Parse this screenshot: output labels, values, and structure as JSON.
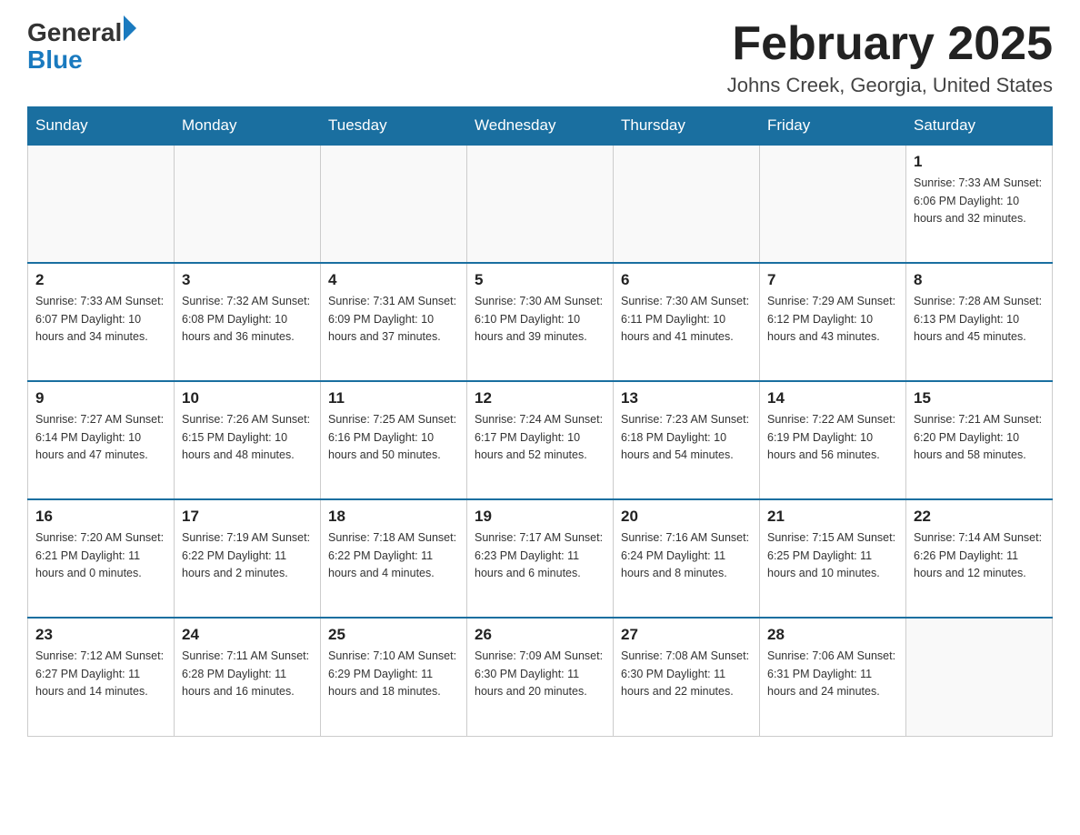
{
  "header": {
    "title": "February 2025",
    "location": "Johns Creek, Georgia, United States",
    "logo_general": "General",
    "logo_blue": "Blue"
  },
  "weekdays": [
    "Sunday",
    "Monday",
    "Tuesday",
    "Wednesday",
    "Thursday",
    "Friday",
    "Saturday"
  ],
  "weeks": [
    [
      {
        "day": "",
        "info": ""
      },
      {
        "day": "",
        "info": ""
      },
      {
        "day": "",
        "info": ""
      },
      {
        "day": "",
        "info": ""
      },
      {
        "day": "",
        "info": ""
      },
      {
        "day": "",
        "info": ""
      },
      {
        "day": "1",
        "info": "Sunrise: 7:33 AM\nSunset: 6:06 PM\nDaylight: 10 hours\nand 32 minutes."
      }
    ],
    [
      {
        "day": "2",
        "info": "Sunrise: 7:33 AM\nSunset: 6:07 PM\nDaylight: 10 hours\nand 34 minutes."
      },
      {
        "day": "3",
        "info": "Sunrise: 7:32 AM\nSunset: 6:08 PM\nDaylight: 10 hours\nand 36 minutes."
      },
      {
        "day": "4",
        "info": "Sunrise: 7:31 AM\nSunset: 6:09 PM\nDaylight: 10 hours\nand 37 minutes."
      },
      {
        "day": "5",
        "info": "Sunrise: 7:30 AM\nSunset: 6:10 PM\nDaylight: 10 hours\nand 39 minutes."
      },
      {
        "day": "6",
        "info": "Sunrise: 7:30 AM\nSunset: 6:11 PM\nDaylight: 10 hours\nand 41 minutes."
      },
      {
        "day": "7",
        "info": "Sunrise: 7:29 AM\nSunset: 6:12 PM\nDaylight: 10 hours\nand 43 minutes."
      },
      {
        "day": "8",
        "info": "Sunrise: 7:28 AM\nSunset: 6:13 PM\nDaylight: 10 hours\nand 45 minutes."
      }
    ],
    [
      {
        "day": "9",
        "info": "Sunrise: 7:27 AM\nSunset: 6:14 PM\nDaylight: 10 hours\nand 47 minutes."
      },
      {
        "day": "10",
        "info": "Sunrise: 7:26 AM\nSunset: 6:15 PM\nDaylight: 10 hours\nand 48 minutes."
      },
      {
        "day": "11",
        "info": "Sunrise: 7:25 AM\nSunset: 6:16 PM\nDaylight: 10 hours\nand 50 minutes."
      },
      {
        "day": "12",
        "info": "Sunrise: 7:24 AM\nSunset: 6:17 PM\nDaylight: 10 hours\nand 52 minutes."
      },
      {
        "day": "13",
        "info": "Sunrise: 7:23 AM\nSunset: 6:18 PM\nDaylight: 10 hours\nand 54 minutes."
      },
      {
        "day": "14",
        "info": "Sunrise: 7:22 AM\nSunset: 6:19 PM\nDaylight: 10 hours\nand 56 minutes."
      },
      {
        "day": "15",
        "info": "Sunrise: 7:21 AM\nSunset: 6:20 PM\nDaylight: 10 hours\nand 58 minutes."
      }
    ],
    [
      {
        "day": "16",
        "info": "Sunrise: 7:20 AM\nSunset: 6:21 PM\nDaylight: 11 hours\nand 0 minutes."
      },
      {
        "day": "17",
        "info": "Sunrise: 7:19 AM\nSunset: 6:22 PM\nDaylight: 11 hours\nand 2 minutes."
      },
      {
        "day": "18",
        "info": "Sunrise: 7:18 AM\nSunset: 6:22 PM\nDaylight: 11 hours\nand 4 minutes."
      },
      {
        "day": "19",
        "info": "Sunrise: 7:17 AM\nSunset: 6:23 PM\nDaylight: 11 hours\nand 6 minutes."
      },
      {
        "day": "20",
        "info": "Sunrise: 7:16 AM\nSunset: 6:24 PM\nDaylight: 11 hours\nand 8 minutes."
      },
      {
        "day": "21",
        "info": "Sunrise: 7:15 AM\nSunset: 6:25 PM\nDaylight: 11 hours\nand 10 minutes."
      },
      {
        "day": "22",
        "info": "Sunrise: 7:14 AM\nSunset: 6:26 PM\nDaylight: 11 hours\nand 12 minutes."
      }
    ],
    [
      {
        "day": "23",
        "info": "Sunrise: 7:12 AM\nSunset: 6:27 PM\nDaylight: 11 hours\nand 14 minutes."
      },
      {
        "day": "24",
        "info": "Sunrise: 7:11 AM\nSunset: 6:28 PM\nDaylight: 11 hours\nand 16 minutes."
      },
      {
        "day": "25",
        "info": "Sunrise: 7:10 AM\nSunset: 6:29 PM\nDaylight: 11 hours\nand 18 minutes."
      },
      {
        "day": "26",
        "info": "Sunrise: 7:09 AM\nSunset: 6:30 PM\nDaylight: 11 hours\nand 20 minutes."
      },
      {
        "day": "27",
        "info": "Sunrise: 7:08 AM\nSunset: 6:30 PM\nDaylight: 11 hours\nand 22 minutes."
      },
      {
        "day": "28",
        "info": "Sunrise: 7:06 AM\nSunset: 6:31 PM\nDaylight: 11 hours\nand 24 minutes."
      },
      {
        "day": "",
        "info": ""
      }
    ]
  ]
}
